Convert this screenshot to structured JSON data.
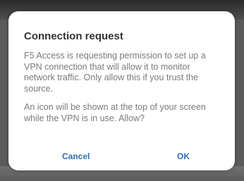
{
  "dialog": {
    "title": "Connection request",
    "message": "F5 Access is requesting permission to set up a VPN connection that will allow it to monitor network traffic. Only allow this if you trust the source.",
    "notice": "An icon will be shown at the top of your screen while the VPN is in use. Allow?",
    "cancel_label": "Cancel",
    "ok_label": "OK"
  },
  "colors": {
    "accent": "#2f6fb0",
    "title_text": "#333333",
    "body_text": "#7a7a7a"
  }
}
